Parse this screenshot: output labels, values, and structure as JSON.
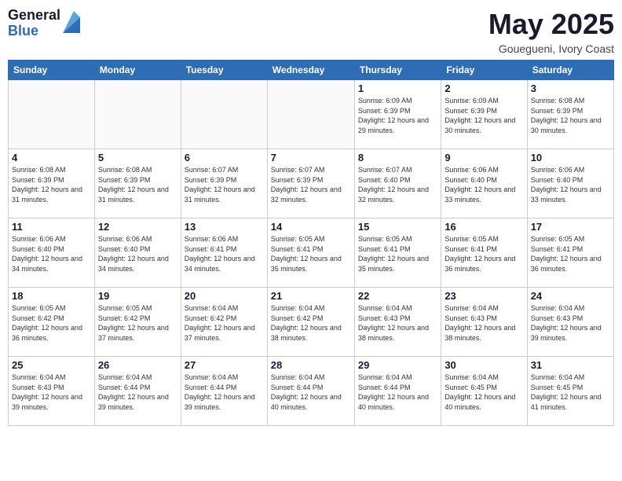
{
  "header": {
    "logo": {
      "general": "General",
      "blue": "Blue"
    },
    "title": "May 2025",
    "location": "Gouegueni, Ivory Coast"
  },
  "weekdays": [
    "Sunday",
    "Monday",
    "Tuesday",
    "Wednesday",
    "Thursday",
    "Friday",
    "Saturday"
  ],
  "weeks": [
    [
      {
        "day": "",
        "info": ""
      },
      {
        "day": "",
        "info": ""
      },
      {
        "day": "",
        "info": ""
      },
      {
        "day": "",
        "info": ""
      },
      {
        "day": "1",
        "info": "Sunrise: 6:09 AM\nSunset: 6:39 PM\nDaylight: 12 hours and 29 minutes."
      },
      {
        "day": "2",
        "info": "Sunrise: 6:09 AM\nSunset: 6:39 PM\nDaylight: 12 hours and 30 minutes."
      },
      {
        "day": "3",
        "info": "Sunrise: 6:08 AM\nSunset: 6:39 PM\nDaylight: 12 hours and 30 minutes."
      }
    ],
    [
      {
        "day": "4",
        "info": "Sunrise: 6:08 AM\nSunset: 6:39 PM\nDaylight: 12 hours and 31 minutes."
      },
      {
        "day": "5",
        "info": "Sunrise: 6:08 AM\nSunset: 6:39 PM\nDaylight: 12 hours and 31 minutes."
      },
      {
        "day": "6",
        "info": "Sunrise: 6:07 AM\nSunset: 6:39 PM\nDaylight: 12 hours and 31 minutes."
      },
      {
        "day": "7",
        "info": "Sunrise: 6:07 AM\nSunset: 6:39 PM\nDaylight: 12 hours and 32 minutes."
      },
      {
        "day": "8",
        "info": "Sunrise: 6:07 AM\nSunset: 6:40 PM\nDaylight: 12 hours and 32 minutes."
      },
      {
        "day": "9",
        "info": "Sunrise: 6:06 AM\nSunset: 6:40 PM\nDaylight: 12 hours and 33 minutes."
      },
      {
        "day": "10",
        "info": "Sunrise: 6:06 AM\nSunset: 6:40 PM\nDaylight: 12 hours and 33 minutes."
      }
    ],
    [
      {
        "day": "11",
        "info": "Sunrise: 6:06 AM\nSunset: 6:40 PM\nDaylight: 12 hours and 34 minutes."
      },
      {
        "day": "12",
        "info": "Sunrise: 6:06 AM\nSunset: 6:40 PM\nDaylight: 12 hours and 34 minutes."
      },
      {
        "day": "13",
        "info": "Sunrise: 6:06 AM\nSunset: 6:41 PM\nDaylight: 12 hours and 34 minutes."
      },
      {
        "day": "14",
        "info": "Sunrise: 6:05 AM\nSunset: 6:41 PM\nDaylight: 12 hours and 35 minutes."
      },
      {
        "day": "15",
        "info": "Sunrise: 6:05 AM\nSunset: 6:41 PM\nDaylight: 12 hours and 35 minutes."
      },
      {
        "day": "16",
        "info": "Sunrise: 6:05 AM\nSunset: 6:41 PM\nDaylight: 12 hours and 36 minutes."
      },
      {
        "day": "17",
        "info": "Sunrise: 6:05 AM\nSunset: 6:41 PM\nDaylight: 12 hours and 36 minutes."
      }
    ],
    [
      {
        "day": "18",
        "info": "Sunrise: 6:05 AM\nSunset: 6:42 PM\nDaylight: 12 hours and 36 minutes."
      },
      {
        "day": "19",
        "info": "Sunrise: 6:05 AM\nSunset: 6:42 PM\nDaylight: 12 hours and 37 minutes."
      },
      {
        "day": "20",
        "info": "Sunrise: 6:04 AM\nSunset: 6:42 PM\nDaylight: 12 hours and 37 minutes."
      },
      {
        "day": "21",
        "info": "Sunrise: 6:04 AM\nSunset: 6:42 PM\nDaylight: 12 hours and 38 minutes."
      },
      {
        "day": "22",
        "info": "Sunrise: 6:04 AM\nSunset: 6:43 PM\nDaylight: 12 hours and 38 minutes."
      },
      {
        "day": "23",
        "info": "Sunrise: 6:04 AM\nSunset: 6:43 PM\nDaylight: 12 hours and 38 minutes."
      },
      {
        "day": "24",
        "info": "Sunrise: 6:04 AM\nSunset: 6:43 PM\nDaylight: 12 hours and 39 minutes."
      }
    ],
    [
      {
        "day": "25",
        "info": "Sunrise: 6:04 AM\nSunset: 6:43 PM\nDaylight: 12 hours and 39 minutes."
      },
      {
        "day": "26",
        "info": "Sunrise: 6:04 AM\nSunset: 6:44 PM\nDaylight: 12 hours and 39 minutes."
      },
      {
        "day": "27",
        "info": "Sunrise: 6:04 AM\nSunset: 6:44 PM\nDaylight: 12 hours and 39 minutes."
      },
      {
        "day": "28",
        "info": "Sunrise: 6:04 AM\nSunset: 6:44 PM\nDaylight: 12 hours and 40 minutes."
      },
      {
        "day": "29",
        "info": "Sunrise: 6:04 AM\nSunset: 6:44 PM\nDaylight: 12 hours and 40 minutes."
      },
      {
        "day": "30",
        "info": "Sunrise: 6:04 AM\nSunset: 6:45 PM\nDaylight: 12 hours and 40 minutes."
      },
      {
        "day": "31",
        "info": "Sunrise: 6:04 AM\nSunset: 6:45 PM\nDaylight: 12 hours and 41 minutes."
      }
    ]
  ]
}
